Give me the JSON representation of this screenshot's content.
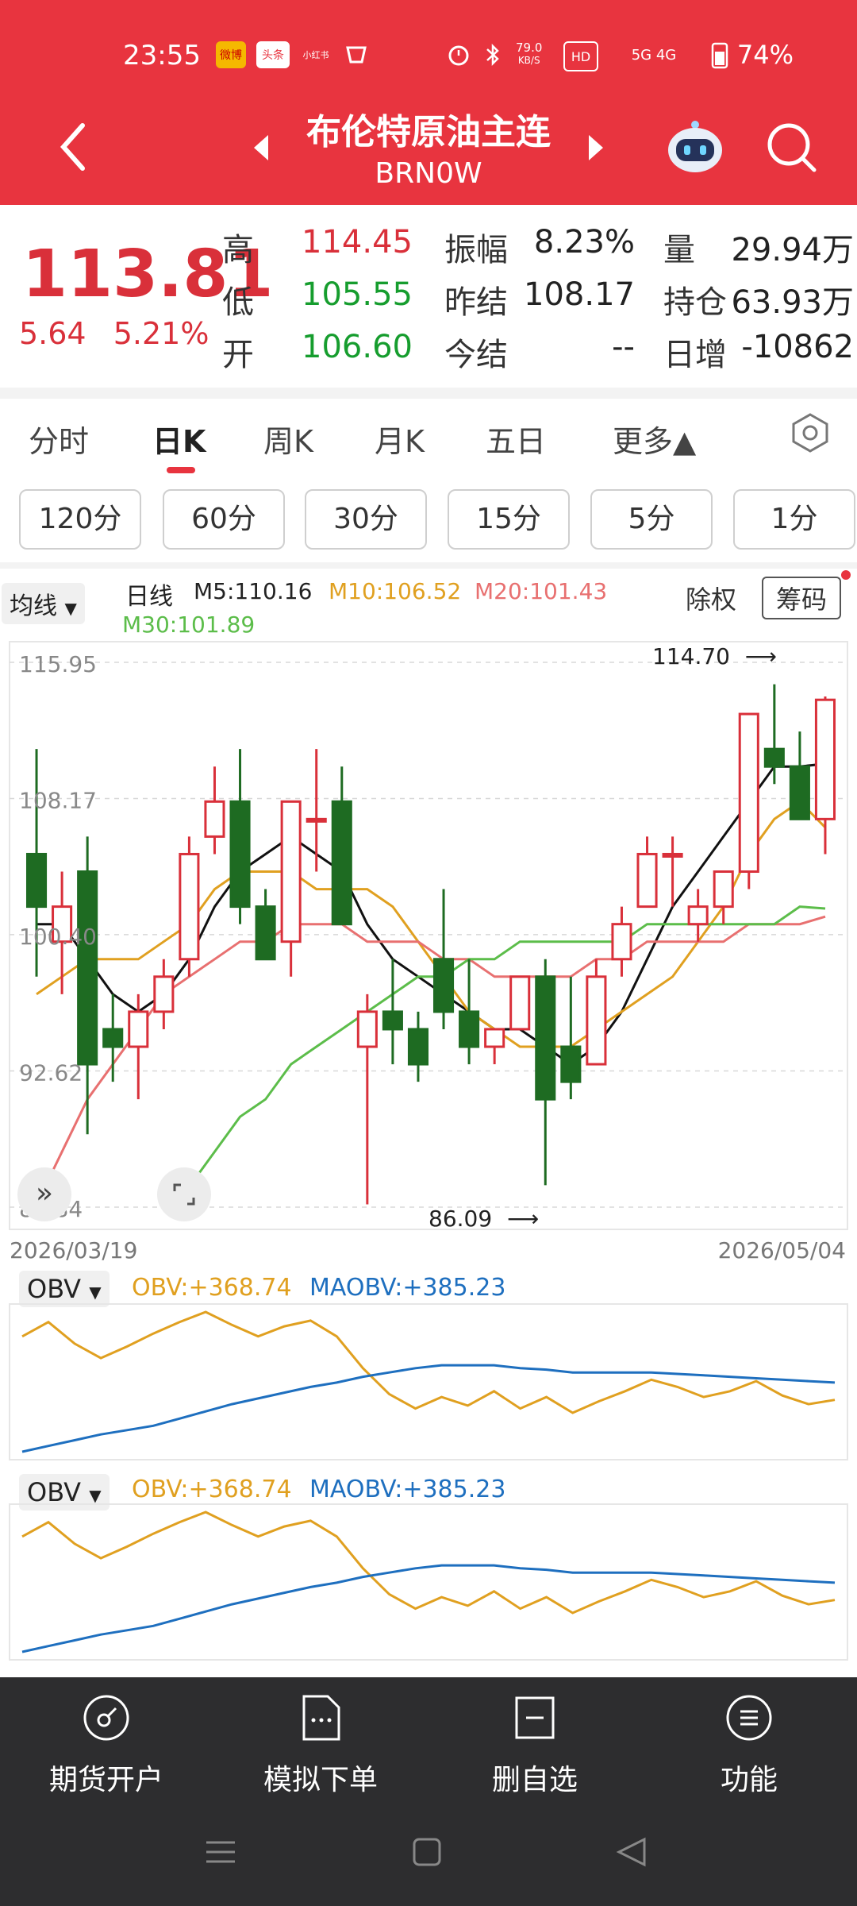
{
  "status_bar": {
    "time": "23:55",
    "speed_value": "79.0",
    "speed_unit": "KB/S",
    "network": "5G 4G",
    "battery": "74%",
    "icon_weibo": "微博",
    "icon_toutiao": "头条",
    "icon_xiaohongshu": "小红书"
  },
  "header": {
    "title": "布伦特原油主连",
    "code": "BRN0W"
  },
  "quote": {
    "price": "113.81",
    "change": "5.64",
    "change_pct": "5.21%",
    "high_label": "高",
    "high": "114.45",
    "low_label": "低",
    "low": "105.55",
    "open_label": "开",
    "open": "106.60",
    "amplitude_label": "振幅",
    "amplitude": "8.23%",
    "prev_settle_label": "昨结",
    "prev_settle": "108.17",
    "settle_label": "今结",
    "settle": "--",
    "volume_label": "量",
    "volume": "29.94万",
    "oi_label": "持仓",
    "oi": "63.93万",
    "oi_change_label": "日增",
    "oi_change": "-10862"
  },
  "tabs": [
    {
      "label": "分时"
    },
    {
      "label": "日K"
    },
    {
      "label": "周K"
    },
    {
      "label": "月K"
    },
    {
      "label": "五日"
    },
    {
      "label": "更多▲"
    }
  ],
  "intervals": [
    "120分",
    "60分",
    "30分",
    "15分",
    "5分",
    "1分"
  ],
  "chart_header": {
    "indicator_select": "均线",
    "period": "日线",
    "m5": "M5:110.16",
    "m10": "M10:106.52",
    "m20": "M20:101.43",
    "m30": "M30:101.89",
    "exright": "除权",
    "chips": "筹码"
  },
  "colors": {
    "up": "#d9303a",
    "down": "#1e6b22",
    "m5": "#111111",
    "m10": "#e0a020",
    "m20": "#e87070",
    "m30": "#5cbd4a",
    "obv": "#e0a020",
    "maobv": "#1e6fbf"
  },
  "chart_data": [
    {
      "type": "candlestick",
      "y_ticks": [
        "115.95",
        "108.17",
        "100.40",
        "92.62",
        "84.84"
      ],
      "ylim": [
        84.84,
        115.95
      ],
      "x_start_label": "2026/03/19",
      "x_end_label": "2026/05/04",
      "max_label": "114.70",
      "min_label": "86.09",
      "candles": [
        {
          "o": 105,
          "h": 111,
          "l": 98,
          "c": 102
        },
        {
          "o": 100,
          "h": 104,
          "l": 97,
          "c": 102
        },
        {
          "o": 104,
          "h": 106,
          "l": 89,
          "c": 93
        },
        {
          "o": 95,
          "h": 97,
          "l": 92,
          "c": 94
        },
        {
          "o": 94,
          "h": 97,
          "l": 91,
          "c": 96
        },
        {
          "o": 96,
          "h": 99,
          "l": 95,
          "c": 98
        },
        {
          "o": 99,
          "h": 106,
          "l": 98,
          "c": 105
        },
        {
          "o": 106,
          "h": 110,
          "l": 105,
          "c": 108
        },
        {
          "o": 108,
          "h": 111,
          "l": 101,
          "c": 102
        },
        {
          "o": 102,
          "h": 103,
          "l": 99,
          "c": 99
        },
        {
          "o": 100,
          "h": 108,
          "l": 98,
          "c": 108
        },
        {
          "o": 107,
          "h": 111,
          "l": 104,
          "c": 107
        },
        {
          "o": 108,
          "h": 110,
          "l": 101,
          "c": 101
        },
        {
          "o": 94,
          "h": 97,
          "l": 85,
          "c": 96
        },
        {
          "o": 96,
          "h": 99,
          "l": 93,
          "c": 95
        },
        {
          "o": 95,
          "h": 96,
          "l": 92,
          "c": 93
        },
        {
          "o": 99,
          "h": 103,
          "l": 95,
          "c": 96
        },
        {
          "o": 96,
          "h": 99,
          "l": 93,
          "c": 94
        },
        {
          "o": 94,
          "h": 95,
          "l": 93,
          "c": 95
        },
        {
          "o": 95,
          "h": 98,
          "l": 95,
          "c": 98
        },
        {
          "o": 98,
          "h": 99,
          "l": 86.09,
          "c": 91
        },
        {
          "o": 94,
          "h": 98,
          "l": 91,
          "c": 92
        },
        {
          "o": 93,
          "h": 99,
          "l": 93,
          "c": 98
        },
        {
          "o": 99,
          "h": 102,
          "l": 98,
          "c": 101
        },
        {
          "o": 102,
          "h": 106,
          "l": 102,
          "c": 105
        },
        {
          "o": 105,
          "h": 106,
          "l": 102,
          "c": 105
        },
        {
          "o": 101,
          "h": 103,
          "l": 100,
          "c": 102
        },
        {
          "o": 102,
          "h": 104,
          "l": 101,
          "c": 104
        },
        {
          "o": 104,
          "h": 113,
          "l": 103,
          "c": 113
        },
        {
          "o": 111,
          "h": 114.7,
          "l": 109,
          "c": 110
        },
        {
          "o": 110,
          "h": 112,
          "l": 107,
          "c": 107
        },
        {
          "o": 107,
          "h": 114,
          "l": 105,
          "c": 113.81
        }
      ],
      "series": [
        {
          "name": "M5",
          "values": [
            101,
            101,
            99,
            97,
            96,
            97,
            99,
            102,
            104,
            105,
            106,
            105,
            104,
            101,
            99,
            98,
            97,
            96,
            95,
            95,
            94,
            93,
            94,
            96,
            99,
            102,
            104,
            106,
            108,
            110,
            110,
            110.16
          ]
        },
        {
          "name": "M10",
          "values": [
            97,
            98,
            99,
            99,
            99,
            100,
            101,
            103,
            104,
            104,
            104,
            103,
            103,
            103,
            102,
            100,
            98,
            96,
            95,
            94,
            94,
            94,
            95,
            96,
            97,
            98,
            100,
            102,
            105,
            107,
            108,
            106.52
          ]
        },
        {
          "name": "M20",
          "values": [
            85,
            88,
            91,
            93,
            95,
            97,
            98,
            99,
            100,
            100,
            101,
            101,
            101,
            100,
            100,
            100,
            99,
            99,
            98,
            98,
            98,
            98,
            99,
            99,
            100,
            100,
            100,
            100,
            101,
            101,
            101,
            101.43
          ]
        },
        {
          "name": "M30",
          "values": [
            null,
            null,
            null,
            null,
            null,
            null,
            86,
            88,
            90,
            91,
            93,
            94,
            95,
            96,
            97,
            98,
            98,
            99,
            99,
            100,
            100,
            100,
            100,
            100,
            101,
            101,
            101,
            101,
            101,
            101,
            102,
            101.89
          ]
        }
      ]
    },
    {
      "type": "line",
      "indicator_select": "OBV",
      "obv_label": "OBV:+368.74",
      "maobv_label": "MAOBV:+385.23",
      "series": [
        {
          "name": "OBV",
          "values": [
            80,
            90,
            75,
            65,
            73,
            82,
            90,
            97,
            88,
            80,
            87,
            91,
            80,
            58,
            40,
            30,
            38,
            32,
            42,
            30,
            38,
            27,
            35,
            42,
            50,
            45,
            38,
            42,
            49,
            39,
            33,
            36
          ]
        },
        {
          "name": "MAOBV",
          "values": [
            0,
            4,
            8,
            12,
            15,
            18,
            23,
            28,
            33,
            37,
            41,
            45,
            48,
            52,
            55,
            58,
            60,
            60,
            60,
            58,
            57,
            55,
            55,
            55,
            55,
            54,
            53,
            52,
            51,
            50,
            49,
            48
          ]
        }
      ]
    },
    {
      "type": "line",
      "indicator_select": "OBV",
      "obv_label": "OBV:+368.74",
      "maobv_label": "MAOBV:+385.23",
      "series": [
        {
          "name": "OBV",
          "values": [
            80,
            90,
            75,
            65,
            73,
            82,
            90,
            97,
            88,
            80,
            87,
            91,
            80,
            58,
            40,
            30,
            38,
            32,
            42,
            30,
            38,
            27,
            35,
            42,
            50,
            45,
            38,
            42,
            49,
            39,
            33,
            36
          ]
        },
        {
          "name": "MAOBV",
          "values": [
            0,
            4,
            8,
            12,
            15,
            18,
            23,
            28,
            33,
            37,
            41,
            45,
            48,
            52,
            55,
            58,
            60,
            60,
            60,
            58,
            57,
            55,
            55,
            55,
            55,
            54,
            53,
            52,
            51,
            50,
            49,
            48
          ]
        }
      ]
    }
  ],
  "bottom_nav": [
    {
      "label": "期货开户",
      "icon": "compass-icon"
    },
    {
      "label": "模拟下单",
      "icon": "document-icon"
    },
    {
      "label": "删自选",
      "icon": "minus-box-icon"
    },
    {
      "label": "功能",
      "icon": "menu-circle-icon"
    }
  ]
}
